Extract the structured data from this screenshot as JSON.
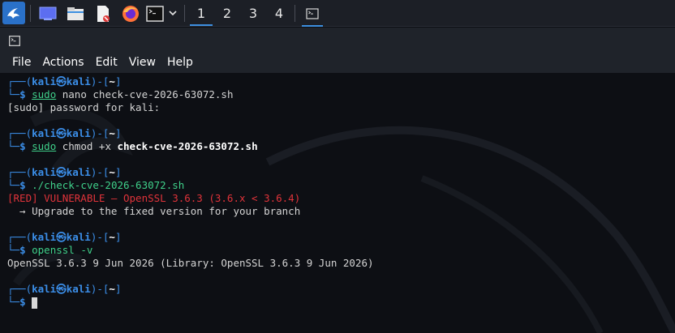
{
  "taskbar": {
    "apps": [
      {
        "name": "kali-menu-icon"
      },
      {
        "name": "desktop-icon"
      },
      {
        "name": "file-manager-icon"
      },
      {
        "name": "text-editor-icon"
      },
      {
        "name": "firefox-icon"
      },
      {
        "name": "terminal-icon"
      }
    ],
    "workspaces": [
      "1",
      "2",
      "3",
      "4"
    ],
    "active_workspace": "1",
    "colors": {
      "accent": "#3d8fe0",
      "background": "#1c1f26"
    }
  },
  "menubar": {
    "items": [
      "File",
      "Actions",
      "Edit",
      "View",
      "Help"
    ]
  },
  "prompt": {
    "user": "kali",
    "symbol": "㉿",
    "host": "kali",
    "dir": "~",
    "dollar": "$"
  },
  "terminal": {
    "blocks": [
      {
        "command": "sudo",
        "args": " nano check-cve-2026-63072.sh",
        "output": [
          "[sudo] password for kali:"
        ]
      },
      {
        "command": "sudo",
        "args_pre": " chmod +x ",
        "args_bold": "check-cve-2026-63072.sh",
        "output": []
      },
      {
        "command": "./check-cve-2026-63072.sh",
        "output_red": "[RED] VULNERABLE — OpenSSL 3.6.3 (3.6.x < 3.6.4)",
        "output": [
          "  → Upgrade to the fixed version for your branch"
        ]
      },
      {
        "command": "openssl",
        "args": " -v",
        "output": [
          "OpenSSL 3.6.3 9 Jun 2026 (Library: OpenSSL 3.6.3 9 Jun 2026)"
        ]
      }
    ],
    "colors": {
      "prompt": "#3b8ee8",
      "command": "#3fd08a",
      "error": "#e0333a",
      "text": "#d4d4d4"
    }
  }
}
